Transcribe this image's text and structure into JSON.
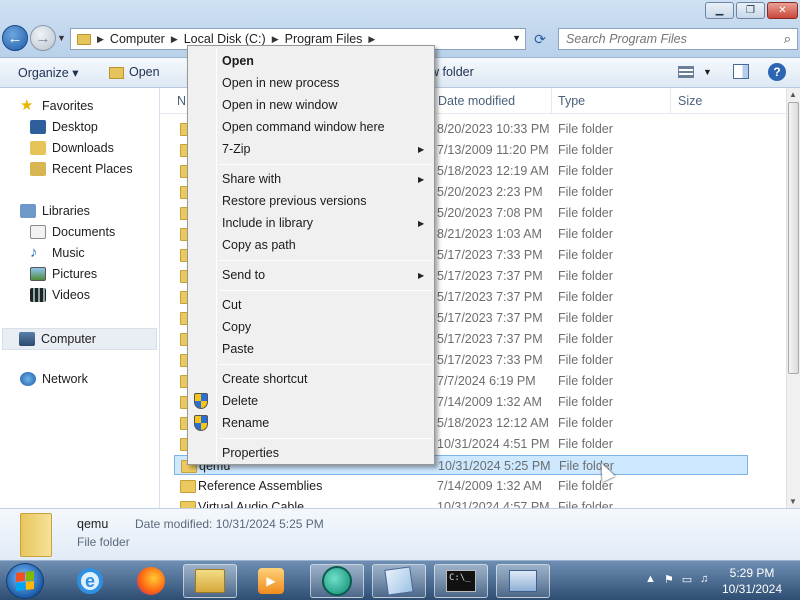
{
  "address": {
    "crumbs": [
      "Computer",
      "Local Disk (C:)",
      "Program Files"
    ]
  },
  "search": {
    "placeholder": "Search Program Files"
  },
  "toolbar": {
    "organize": "Organize ▾",
    "open": "Open",
    "new_folder": "w folder"
  },
  "nav": {
    "favorites": "Favorites",
    "desktop": "Desktop",
    "downloads": "Downloads",
    "recent": "Recent Places",
    "libraries": "Libraries",
    "documents": "Documents",
    "music": "Music",
    "pictures": "Pictures",
    "videos": "Videos",
    "computer": "Computer",
    "network": "Network"
  },
  "columns": {
    "name": "N",
    "date": "Date modified",
    "type": "Type",
    "size": "Size"
  },
  "files": [
    {
      "name": "",
      "date": "8/20/2023 10:33 PM",
      "type": "File folder"
    },
    {
      "name": "",
      "date": "7/13/2009 11:20 PM",
      "type": "File folder"
    },
    {
      "name": "",
      "date": "5/18/2023 12:19 AM",
      "type": "File folder"
    },
    {
      "name": "",
      "date": "5/20/2023 2:23 PM",
      "type": "File folder"
    },
    {
      "name": "",
      "date": "5/20/2023 7:08 PM",
      "type": "File folder"
    },
    {
      "name": "",
      "date": "8/21/2023 1:03 AM",
      "type": "File folder"
    },
    {
      "name": "",
      "date": "5/17/2023 7:33 PM",
      "type": "File folder"
    },
    {
      "name": "",
      "date": "5/17/2023 7:37 PM",
      "type": "File folder"
    },
    {
      "name": "",
      "date": "5/17/2023 7:37 PM",
      "type": "File folder"
    },
    {
      "name": "",
      "date": "5/17/2023 7:37 PM",
      "type": "File folder"
    },
    {
      "name": "",
      "date": "5/17/2023 7:37 PM",
      "type": "File folder"
    },
    {
      "name": "",
      "date": "5/17/2023 7:33 PM",
      "type": "File folder"
    },
    {
      "name": "",
      "date": "7/7/2024 6:19 PM",
      "type": "File folder"
    },
    {
      "name": "",
      "date": "7/14/2009 1:32 AM",
      "type": "File folder"
    },
    {
      "name": "",
      "date": "5/18/2023 12:12 AM",
      "type": "File folder"
    },
    {
      "name": "",
      "date": "10/31/2024 4:51 PM",
      "type": "File folder"
    },
    {
      "name": "qemu",
      "date": "10/31/2024 5:25 PM",
      "type": "File folder"
    },
    {
      "name": "Reference Assemblies",
      "date": "7/14/2009 1:32 AM",
      "type": "File folder"
    },
    {
      "name": "Virtual Audio Cable",
      "date": "10/31/2024 4:57 PM",
      "type": "File folder"
    }
  ],
  "details": {
    "name": "qemu",
    "modified": "Date modified: 10/31/2024 5:25 PM",
    "type": "File folder"
  },
  "context_menu": {
    "open": "Open",
    "open_new_process": "Open in new process",
    "open_new_window": "Open in new window",
    "open_cmd": "Open command window here",
    "zip": "7-Zip",
    "share_with": "Share with",
    "restore": "Restore previous versions",
    "include": "Include in library",
    "copy_path": "Copy as path",
    "send_to": "Send to",
    "cut": "Cut",
    "copy": "Copy",
    "paste": "Paste",
    "create_shortcut": "Create shortcut",
    "delete": "Delete",
    "rename": "Rename",
    "properties": "Properties"
  },
  "clock": {
    "time": "5:29 PM",
    "date": "10/31/2024"
  },
  "colors": {
    "selection": "#cde8ff",
    "selection_border": "#7eb4ea",
    "taskbar": "#2e4d73"
  }
}
